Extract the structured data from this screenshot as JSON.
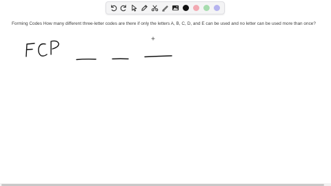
{
  "toolbar": {
    "tools": [
      {
        "icon": "undo-icon"
      },
      {
        "icon": "redo-icon"
      },
      {
        "icon": "select-arrow-icon"
      },
      {
        "icon": "pen-icon"
      },
      {
        "icon": "scissors-icon"
      },
      {
        "icon": "highlighter-icon"
      },
      {
        "icon": "image-icon"
      }
    ],
    "colors": [
      "#111111",
      "#f2a9b2",
      "#a6dcae",
      "#b5b3ef"
    ]
  },
  "question": {
    "text": "Forming Codes How many different three-letter codes are there if only the letters A, B, C, D, and E can be used and no letter can be used more than once?"
  },
  "handwriting": {
    "label": "FCP",
    "blanks": 3
  }
}
